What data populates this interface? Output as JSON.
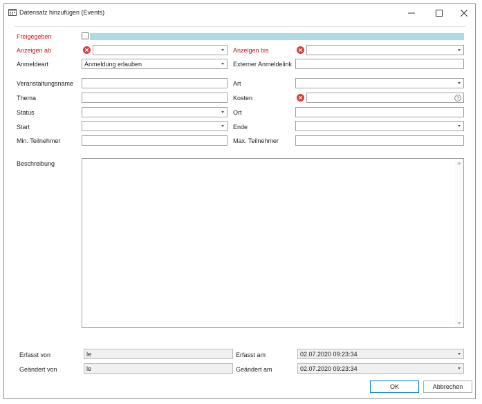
{
  "window": {
    "title": "Datensatz hinzufügen (Events)",
    "minimize_icon": "minimize-icon",
    "maximize_icon": "maximize-icon",
    "close_icon": "close-icon"
  },
  "colors": {
    "required": "#c0161b",
    "highlight_bar": "#aed9e6",
    "ok_border": "#0078d7"
  },
  "form": {
    "freigegeben": {
      "label": "Freigegeben",
      "checked": false
    },
    "anzeigen_ab": {
      "label": "Anzeigen ab",
      "value": ""
    },
    "anzeigen_bis": {
      "label": "Anzeigen bis",
      "value": ""
    },
    "anmeldeart": {
      "label": "Anmeldeart",
      "value": "Anmeldung erlauben"
    },
    "externer_anmeldelink": {
      "label": "Externer Anmeldelink",
      "value": ""
    },
    "veranstaltungsname": {
      "label": "Veranstaltungsname",
      "value": ""
    },
    "art": {
      "label": "Art",
      "value": ""
    },
    "thema": {
      "label": "Thema",
      "value": ""
    },
    "kosten": {
      "label": "Kosten",
      "value": ""
    },
    "status": {
      "label": "Status",
      "value": ""
    },
    "ort": {
      "label": "Ort",
      "value": ""
    },
    "start": {
      "label": "Start",
      "value": ""
    },
    "ende": {
      "label": "Ende",
      "value": ""
    },
    "min_teilnehmer": {
      "label": "Min. Teilnehmer",
      "value": ""
    },
    "max_teilnehmer": {
      "label": "Max. Teilnehmer",
      "value": ""
    },
    "beschreibung": {
      "label": "Beschreibung",
      "value": ""
    }
  },
  "audit": {
    "erfasst_von": {
      "label": "Erfasst von",
      "value": "le"
    },
    "geaendert_von": {
      "label": "Geändert von",
      "value": "le"
    },
    "erfasst_am": {
      "label": "Erfasst am",
      "value": "02.07.2020 09:23:34"
    },
    "geaendert_am": {
      "label": "Geändert am",
      "value": "02.07.2020 09:23:34"
    }
  },
  "buttons": {
    "ok": "OK",
    "cancel": "Abbrechen"
  }
}
